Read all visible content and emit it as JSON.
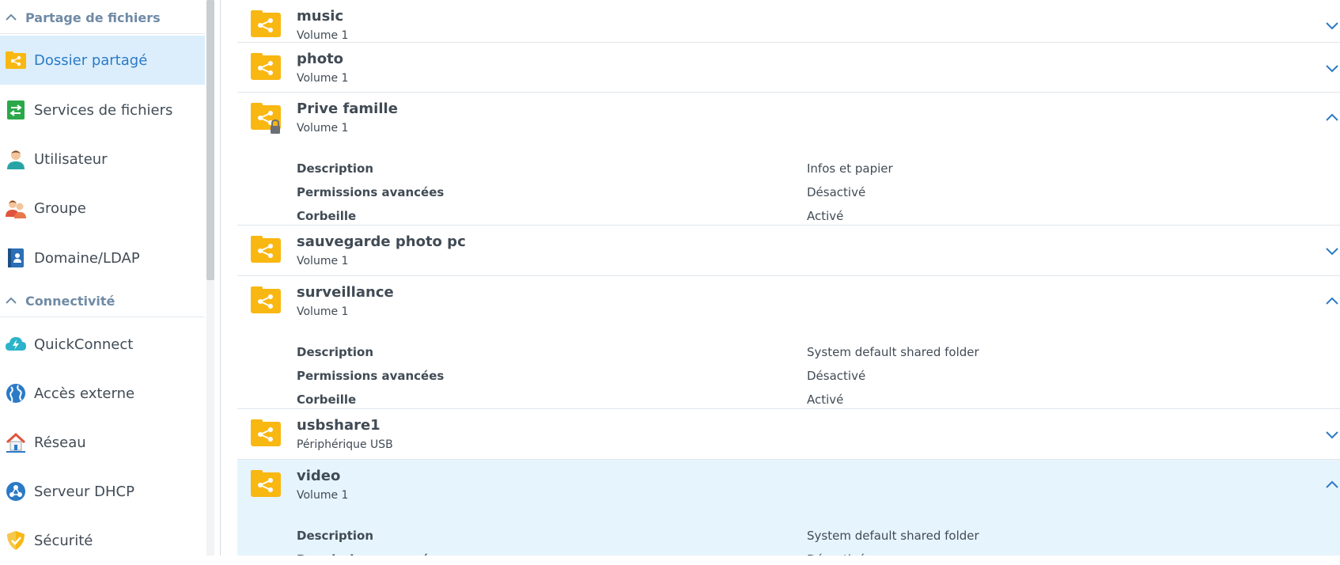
{
  "sidebar": {
    "section_file_sharing": "Partage de fichiers",
    "section_connectivity": "Connectivité",
    "items": [
      {
        "label": "Dossier partagé",
        "icon": "shared-folder-icon"
      },
      {
        "label": "Services de fichiers",
        "icon": "file-services-icon"
      },
      {
        "label": "Utilisateur",
        "icon": "user-icon"
      },
      {
        "label": "Groupe",
        "icon": "group-icon"
      },
      {
        "label": "Domaine/LDAP",
        "icon": "domain-ldap-icon"
      },
      {
        "label": "QuickConnect",
        "icon": "quickconnect-icon"
      },
      {
        "label": "Accès externe",
        "icon": "external-access-icon"
      },
      {
        "label": "Réseau",
        "icon": "network-icon"
      },
      {
        "label": "Serveur DHCP",
        "icon": "dhcp-server-icon"
      },
      {
        "label": "Sécurité",
        "icon": "security-icon"
      }
    ],
    "active_item": "Dossier partagé"
  },
  "shares": [
    {
      "name": "music",
      "location": "Volume 1",
      "expanded": false,
      "locked": false
    },
    {
      "name": "photo",
      "location": "Volume 1",
      "expanded": false,
      "locked": false
    },
    {
      "name": "Prive famille",
      "location": "Volume 1",
      "expanded": true,
      "locked": true,
      "props": [
        {
          "label": "Description",
          "value": "Infos et papier"
        },
        {
          "label": "Permissions avancées",
          "value": "Désactivé"
        },
        {
          "label": "Corbeille",
          "value": "Activé"
        }
      ]
    },
    {
      "name": "sauvegarde photo pc",
      "location": "Volume 1",
      "expanded": false,
      "locked": false
    },
    {
      "name": "surveillance",
      "location": "Volume 1",
      "expanded": true,
      "locked": false,
      "props": [
        {
          "label": "Description",
          "value": "System default shared folder"
        },
        {
          "label": "Permissions avancées",
          "value": "Désactivé"
        },
        {
          "label": "Corbeille",
          "value": "Activé"
        }
      ]
    },
    {
      "name": "usbshare1",
      "location": "Périphérique USB",
      "expanded": false,
      "locked": false
    },
    {
      "name": "video",
      "location": "Volume 1",
      "expanded": true,
      "locked": false,
      "selected": true,
      "props": [
        {
          "label": "Description",
          "value": "System default shared folder"
        },
        {
          "label": "Permissions avancées",
          "value": "Désactivé"
        }
      ]
    }
  ],
  "colors": {
    "accent": "#2b7ac6",
    "folder": "#f9b712",
    "selected_row": "#e6f4fd",
    "active_nav": "#dceefc",
    "section_header": "#6f8aa6"
  }
}
